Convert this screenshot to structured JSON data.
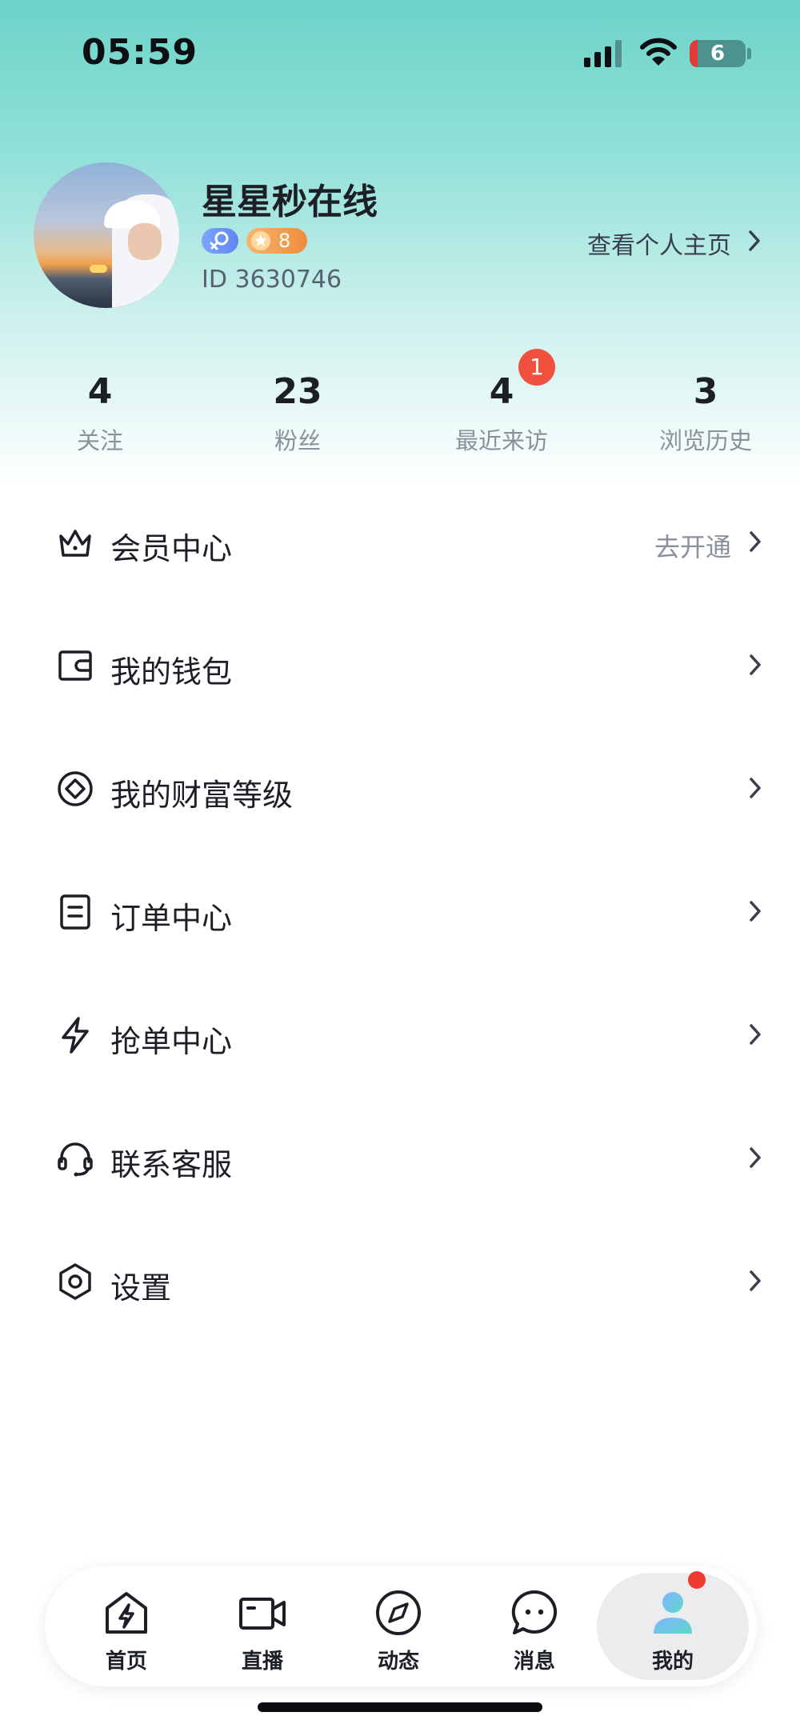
{
  "status_bar": {
    "time": "05:59",
    "battery_level": "6"
  },
  "profile": {
    "username": "星星秒在线",
    "level_badge": "8",
    "user_id": "ID 3630746",
    "view_profile_label": "查看个人主页"
  },
  "stats": [
    {
      "value": "4",
      "label": "关注"
    },
    {
      "value": "23",
      "label": "粉丝"
    },
    {
      "value": "4",
      "label": "最近来访",
      "badge": "1"
    },
    {
      "value": "3",
      "label": "浏览历史"
    }
  ],
  "menu": [
    {
      "label": "会员中心",
      "hint": "去开通",
      "icon": "crown-icon"
    },
    {
      "label": "我的钱包",
      "icon": "wallet-icon"
    },
    {
      "label": "我的财富等级",
      "icon": "diamond-level-icon"
    },
    {
      "label": "订单中心",
      "icon": "order-document-icon"
    },
    {
      "label": "抢单中心",
      "icon": "lightning-icon"
    },
    {
      "label": "联系客服",
      "icon": "headset-icon"
    },
    {
      "label": "设置",
      "icon": "settings-hexagon-icon"
    }
  ],
  "bottom_nav": [
    {
      "label": "首页",
      "icon": "home-lightning-icon"
    },
    {
      "label": "直播",
      "icon": "video-camera-icon"
    },
    {
      "label": "动态",
      "icon": "compass-icon"
    },
    {
      "label": "消息",
      "icon": "chat-bubble-icon"
    },
    {
      "label": "我的",
      "icon": "profile-person-icon",
      "active": true
    }
  ],
  "colors": {
    "header_gradient_top": "#6dd3c8",
    "badge_red": "#f0513f",
    "level_badge_orange": "#ef8c3d",
    "level_badge_blue": "#5f86ee",
    "text_primary": "#1c1f26",
    "text_secondary": "#8a919c"
  }
}
